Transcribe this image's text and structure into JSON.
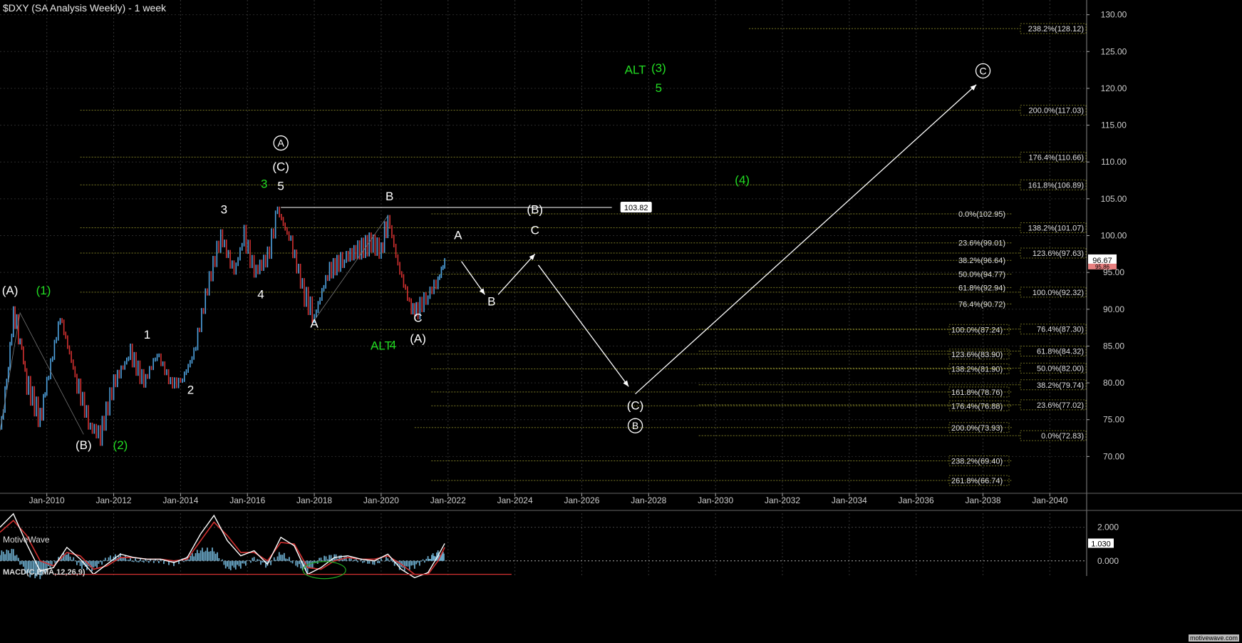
{
  "title": "$DXY (SA Analysis Weekly) - 1 week",
  "brand": "MotiveWave",
  "footer_brand": "motivewave.com",
  "macd": {
    "title": "MACD(C,EMA,12,26,9)",
    "ticks": [
      "2.000",
      "0.000"
    ],
    "value_badge": "1.030"
  },
  "price_badges": {
    "last": "96.67",
    "prev": "95.86"
  },
  "hline_label": "103.82",
  "chart_data": {
    "type": "line",
    "title": "$DXY (SA Analysis Weekly) - 1 week",
    "ylim": [
      65,
      132
    ],
    "y_ticks": [
      70,
      75,
      80,
      85,
      90,
      95,
      100,
      105,
      110,
      115,
      120,
      125,
      130
    ],
    "y_tick_labels": [
      "70.00",
      "75.00",
      "80.00",
      "85.00",
      "90.00",
      "95.00",
      "100.00",
      "105.00",
      "110.00",
      "115.00",
      "120.00",
      "125.00",
      "130.00"
    ],
    "x_ticks": [
      "Jan-2010",
      "Jan-2012",
      "Jan-2014",
      "Jan-2016",
      "Jan-2018",
      "Jan-2020",
      "Jan-2022",
      "Jan-2024",
      "Jan-2026",
      "Jan-2028",
      "Jan-2030",
      "Jan-2032",
      "Jan-2034",
      "Jan-2036",
      "Jan-2038",
      "Jan-2040"
    ],
    "x_tick_years": [
      2010,
      2012,
      2014,
      2016,
      2018,
      2020,
      2022,
      2024,
      2026,
      2028,
      2030,
      2032,
      2034,
      2036,
      2038,
      2040
    ],
    "xlim": [
      2008.6,
      2041.1
    ],
    "price_series": {
      "name": "$DXY",
      "x": [
        2008.6,
        2008.8,
        2009.0,
        2009.2,
        2009.4,
        2009.8,
        2010.0,
        2010.4,
        2010.9,
        2011.3,
        2011.6,
        2012.0,
        2012.5,
        2012.9,
        2013.3,
        2013.7,
        2014.0,
        2014.4,
        2014.8,
        2015.2,
        2015.6,
        2015.9,
        2016.2,
        2016.6,
        2016.9,
        2017.3,
        2017.7,
        2018.0,
        2018.4,
        2018.9,
        2019.3,
        2019.7,
        2020.0,
        2020.2,
        2020.5,
        2020.9,
        2021.1,
        2021.4,
        2021.7,
        2021.9
      ],
      "y": [
        73.5,
        80,
        89.5,
        86,
        80,
        75,
        80,
        89,
        80,
        74,
        73,
        80,
        84,
        80,
        84,
        80,
        80,
        84,
        93,
        100,
        95,
        100,
        95,
        97,
        103.5,
        99,
        92,
        89,
        95,
        97,
        98,
        99,
        98,
        102.5,
        96,
        90,
        90,
        92,
        94,
        96.7
      ]
    },
    "price_labels": [
      {
        "text": "(A)",
        "x": 2008.9,
        "y": 92,
        "color": "#ffffff"
      },
      {
        "text": "(1)",
        "x": 2009.9,
        "y": 92,
        "color": "#22dd22"
      },
      {
        "text": "(B)",
        "x": 2011.1,
        "y": 71,
        "color": "#ffffff"
      },
      {
        "text": "(2)",
        "x": 2012.2,
        "y": 71,
        "color": "#22dd22"
      },
      {
        "text": "1",
        "x": 2013.0,
        "y": 86,
        "color": "#ffffff"
      },
      {
        "text": "2",
        "x": 2014.3,
        "y": 78.5,
        "color": "#ffffff"
      },
      {
        "text": "3",
        "x": 2015.3,
        "y": 103,
        "color": "#ffffff"
      },
      {
        "text": "4",
        "x": 2016.4,
        "y": 91.5,
        "color": "#ffffff"
      },
      {
        "text": "3",
        "x": 2016.5,
        "y": 106.5,
        "color": "#22dd22"
      },
      {
        "text": "5",
        "x": 2017.0,
        "y": 106.2,
        "color": "#ffffff"
      },
      {
        "text": "(C)",
        "x": 2017.0,
        "y": 108.8,
        "color": "#ffffff"
      },
      {
        "text": "A",
        "x": 2018.0,
        "y": 87.5,
        "color": "#ffffff"
      },
      {
        "text": "B",
        "x": 2020.25,
        "y": 104.8,
        "color": "#ffffff"
      },
      {
        "text": "C",
        "x": 2021.1,
        "y": 88.3,
        "color": "#ffffff"
      },
      {
        "text": "(A)",
        "x": 2021.1,
        "y": 85.5,
        "color": "#ffffff"
      },
      {
        "text": "ALT",
        "x": 2020.0,
        "y": 84.5,
        "color": "#22dd22"
      },
      {
        "text": "4",
        "x": 2020.35,
        "y": 84.6,
        "color": "#22dd22"
      },
      {
        "text": "A",
        "x": 2022.3,
        "y": 99.5,
        "color": "#ffffff"
      },
      {
        "text": "B",
        "x": 2023.3,
        "y": 90.5,
        "color": "#ffffff"
      },
      {
        "text": "(B)",
        "x": 2024.6,
        "y": 103,
        "color": "#ffffff"
      },
      {
        "text": "C",
        "x": 2024.6,
        "y": 100.2,
        "color": "#ffffff"
      },
      {
        "text": "(C)",
        "x": 2027.6,
        "y": 76.4,
        "color": "#ffffff"
      },
      {
        "text": "ALT",
        "x": 2027.6,
        "y": 122,
        "color": "#22dd22"
      },
      {
        "text": "(3)",
        "x": 2028.3,
        "y": 122.2,
        "color": "#22dd22"
      },
      {
        "text": "5",
        "x": 2028.3,
        "y": 119.5,
        "color": "#22dd22"
      },
      {
        "text": "(4)",
        "x": 2030.8,
        "y": 107,
        "color": "#22dd22"
      }
    ],
    "circled_labels": [
      {
        "text": "A",
        "x": 2017.0,
        "y": 112,
        "color": "#ffffff"
      },
      {
        "text": "B",
        "x": 2027.6,
        "y": 73.6,
        "color": "#ffffff"
      },
      {
        "text": "C",
        "x": 2038.0,
        "y": 121.8,
        "color": "#ffffff"
      }
    ],
    "arrows": [
      {
        "from": [
          2022.4,
          96.5
        ],
        "to": [
          2023.1,
          92.0
        ]
      },
      {
        "from": [
          2023.5,
          92.0
        ],
        "to": [
          2024.6,
          97.5
        ]
      },
      {
        "from": [
          2024.7,
          96.0
        ],
        "to": [
          2027.4,
          79.5
        ]
      },
      {
        "from": [
          2027.6,
          78.5
        ],
        "to": [
          2037.8,
          120.5
        ]
      }
    ],
    "horizontal_line": {
      "y": 103.82,
      "x_start": 2017.0,
      "x_end": 2026.9
    },
    "fib_left": [
      {
        "label": "100.0%(87.24)",
        "y": 87.24,
        "x_start": 2018.0
      },
      {
        "label": "123.6%(83.90)",
        "y": 83.9,
        "x_start": 2021.5
      },
      {
        "label": "138.2%(81.90)",
        "y": 81.9,
        "x_start": 2021.5
      },
      {
        "label": "161.8%(78.76)",
        "y": 78.76,
        "x_start": 2021.5
      },
      {
        "label": "176.4%(76.88)",
        "y": 76.88,
        "x_start": 2021.5
      },
      {
        "label": "200.0%(73.93)",
        "y": 73.93,
        "x_start": 2021.0
      },
      {
        "label": "238.2%(69.40)",
        "y": 69.4,
        "x_start": 2021.5
      },
      {
        "label": "261.8%(66.74)",
        "y": 66.74,
        "x_start": 2021.5
      }
    ],
    "fib_mid": [
      {
        "label": "0.0%(102.95)",
        "y": 102.95
      },
      {
        "label": "23.6%(99.01)",
        "y": 99.01
      },
      {
        "label": "38.2%(96.64)",
        "y": 96.64
      },
      {
        "label": "50.0%(94.77)",
        "y": 94.77
      },
      {
        "label": "61.8%(92.94)",
        "y": 92.94
      },
      {
        "label": "76.4%(90.72)",
        "y": 90.72
      }
    ],
    "fib_right": [
      {
        "label": "238.2%(128.12)",
        "y": 128.12,
        "x_start": 2031.0
      },
      {
        "label": "200.0%(117.03)",
        "y": 117.03,
        "x_start": 2011.0
      },
      {
        "label": "176.4%(110.66)",
        "y": 110.66,
        "x_start": 2011.0
      },
      {
        "label": "161.8%(106.89)",
        "y": 106.89,
        "x_start": 2011.0
      },
      {
        "label": "138.2%(101.07)",
        "y": 101.07,
        "x_start": 2011.0
      },
      {
        "label": "123.6%(97.63)",
        "y": 97.63,
        "x_start": 2011.0
      },
      {
        "label": "100.0%(92.32)",
        "y": 92.32,
        "x_start": 2011.0
      },
      {
        "label": "76.4%(87.30)",
        "y": 87.3,
        "x_start": 2029.5
      },
      {
        "label": "61.8%(84.32)",
        "y": 84.32,
        "x_start": 2029.5
      },
      {
        "label": "50.0%(82.00)",
        "y": 82.0,
        "x_start": 2029.5
      },
      {
        "label": "38.2%(79.74)",
        "y": 79.74,
        "x_start": 2029.5
      },
      {
        "label": "23.6%(77.02)",
        "y": 77.02,
        "x_start": 2029.5
      },
      {
        "label": "0.0%(72.83)",
        "y": 72.83,
        "x_start": 2029.5
      }
    ],
    "macd_data": {
      "ylim": [
        -0.9,
        3.0
      ],
      "x": [
        2008.6,
        2009.0,
        2009.4,
        2009.8,
        2010.2,
        2010.6,
        2011.0,
        2011.4,
        2011.8,
        2012.2,
        2012.6,
        2013.0,
        2013.4,
        2013.8,
        2014.2,
        2014.6,
        2015.0,
        2015.4,
        2015.8,
        2016.2,
        2016.6,
        2017.0,
        2017.4,
        2017.8,
        2018.2,
        2018.6,
        2019.0,
        2019.4,
        2019.8,
        2020.2,
        2020.6,
        2021.0,
        2021.4,
        2021.7,
        2021.9
      ],
      "macd": [
        2.0,
        2.8,
        1.0,
        -0.6,
        -0.4,
        0.8,
        0.1,
        -0.8,
        -0.2,
        0.4,
        0.2,
        0.1,
        0.1,
        -0.1,
        0.2,
        1.6,
        2.7,
        1.2,
        0.3,
        0.6,
        -0.2,
        1.4,
        0.9,
        -0.8,
        -0.4,
        0.2,
        0.3,
        0.1,
        0.0,
        0.4,
        -0.5,
        -1.0,
        -0.7,
        0.3,
        1.03
      ],
      "signal": [
        1.7,
        2.4,
        1.5,
        0.0,
        -0.3,
        0.5,
        0.3,
        -0.5,
        -0.3,
        0.2,
        0.2,
        0.1,
        0.1,
        0.0,
        0.1,
        1.2,
        2.3,
        1.5,
        0.5,
        0.5,
        0.0,
        1.1,
        1.0,
        -0.4,
        -0.5,
        0.0,
        0.2,
        0.1,
        0.1,
        0.3,
        -0.2,
        -0.8,
        -0.8,
        0.0,
        0.8
      ]
    }
  }
}
